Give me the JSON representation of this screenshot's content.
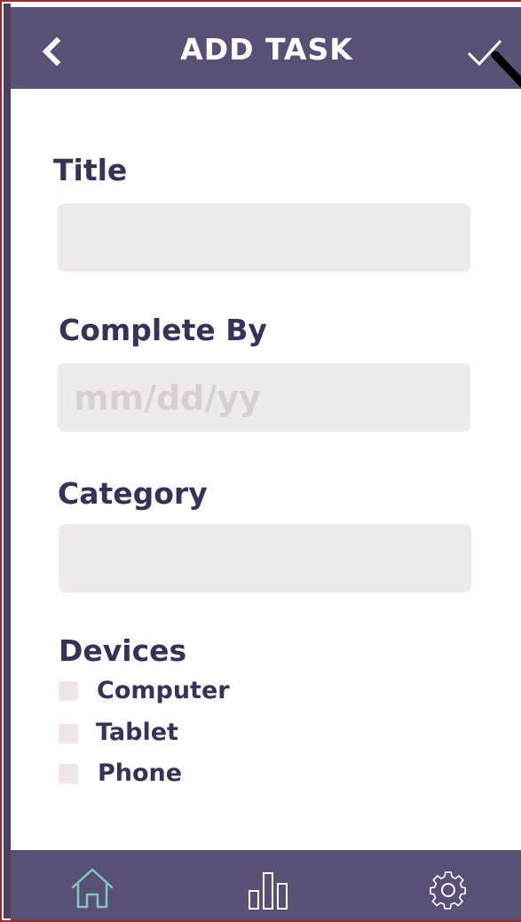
{
  "header": {
    "title": "ADD TASK",
    "back_icon": "back-chevron-icon",
    "confirm_icon": "checkmark-icon"
  },
  "form": {
    "title_label": "Title",
    "title_value": "",
    "complete_by_label": "Complete By",
    "complete_by_placeholder": "mm/dd/yy",
    "category_label": "Category",
    "category_value": "",
    "devices_label": "Devices",
    "devices": [
      {
        "label": "Computer",
        "checked": false
      },
      {
        "label": "Tablet",
        "checked": false
      },
      {
        "label": "Phone",
        "checked": false
      }
    ]
  },
  "tabbar": {
    "items": [
      {
        "icon": "home-icon",
        "active": true
      },
      {
        "icon": "bar-chart-icon",
        "active": false
      },
      {
        "icon": "gear-icon",
        "active": false
      }
    ]
  },
  "colors": {
    "header_bg": "#5a5075",
    "label_text": "#3a3158",
    "field_bg": "#efeaeb",
    "placeholder": "#d6d0d2",
    "active_tab_icon": "#7fc8c6",
    "inactive_tab_icon": "#ffffff"
  }
}
